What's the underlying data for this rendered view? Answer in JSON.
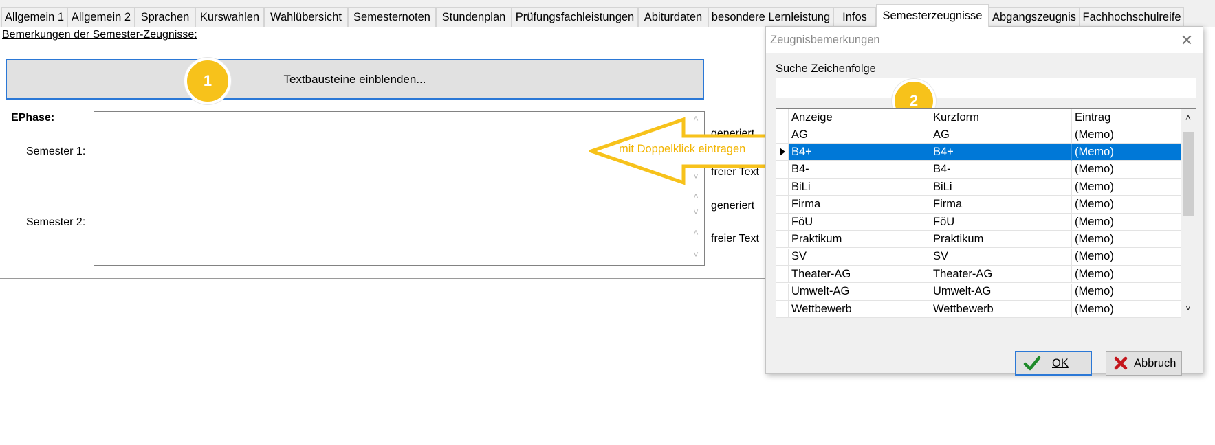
{
  "tabs": [
    "Allgemein 1",
    "Allgemein 2",
    "Sprachen",
    "Kurswahlen",
    "Wahlübersicht",
    "Semesternoten",
    "Stundenplan",
    "Prüfungsfachleistungen",
    "Abiturdaten",
    "besondere Lernleistung",
    "Infos",
    "Semesterzeugnisse",
    "Abgangszeugnis",
    "Fachhochschulreife"
  ],
  "active_tab": "Semesterzeugnisse",
  "main": {
    "remark_label": "Bemerkungen der Semester-Zeugnisse:",
    "textbausteine_button": "Textbausteine einblenden...",
    "ephase_label": "EPhase:",
    "semester1_label": "Semester 1:",
    "semester2_label": "Semester 2:",
    "generiert_label": "generiert",
    "freier_text_label": "freier Text"
  },
  "callouts": {
    "badge1": "1",
    "badge2": "2",
    "arrow_text": "mit Doppelklick eintragen",
    "color": "#f7c21b"
  },
  "dialog": {
    "title": "Zeugnisbemerkungen",
    "close_icon": "close-icon",
    "search_label": "Suche Zeichenfolge",
    "search_value": "",
    "columns": [
      "Anzeige",
      "Kurzform",
      "Eintrag"
    ],
    "rows": [
      [
        "AG",
        "AG",
        "(Memo)"
      ],
      [
        "B4+",
        "B4+",
        "(Memo)"
      ],
      [
        "B4-",
        "B4-",
        "(Memo)"
      ],
      [
        "BiLi",
        "BiLi",
        "(Memo)"
      ],
      [
        "Firma",
        "Firma",
        "(Memo)"
      ],
      [
        "FöU",
        "FöU",
        "(Memo)"
      ],
      [
        "Praktikum",
        "Praktikum",
        "(Memo)"
      ],
      [
        "SV",
        "SV",
        "(Memo)"
      ],
      [
        "Theater-AG",
        "Theater-AG",
        "(Memo)"
      ],
      [
        "Umwelt-AG",
        "Umwelt-AG",
        "(Memo)"
      ],
      [
        "Wettbewerb",
        "Wettbewerb",
        "(Memo)"
      ]
    ],
    "selected_row": 1,
    "ok_label": "OK",
    "cancel_label": "Abbruch"
  },
  "colors": {
    "accent": "#0078d7",
    "focus_border": "#2b78d6",
    "callout": "#f7c21b",
    "ok_check": "#1f8a2a",
    "cancel_x": "#c4161c"
  }
}
